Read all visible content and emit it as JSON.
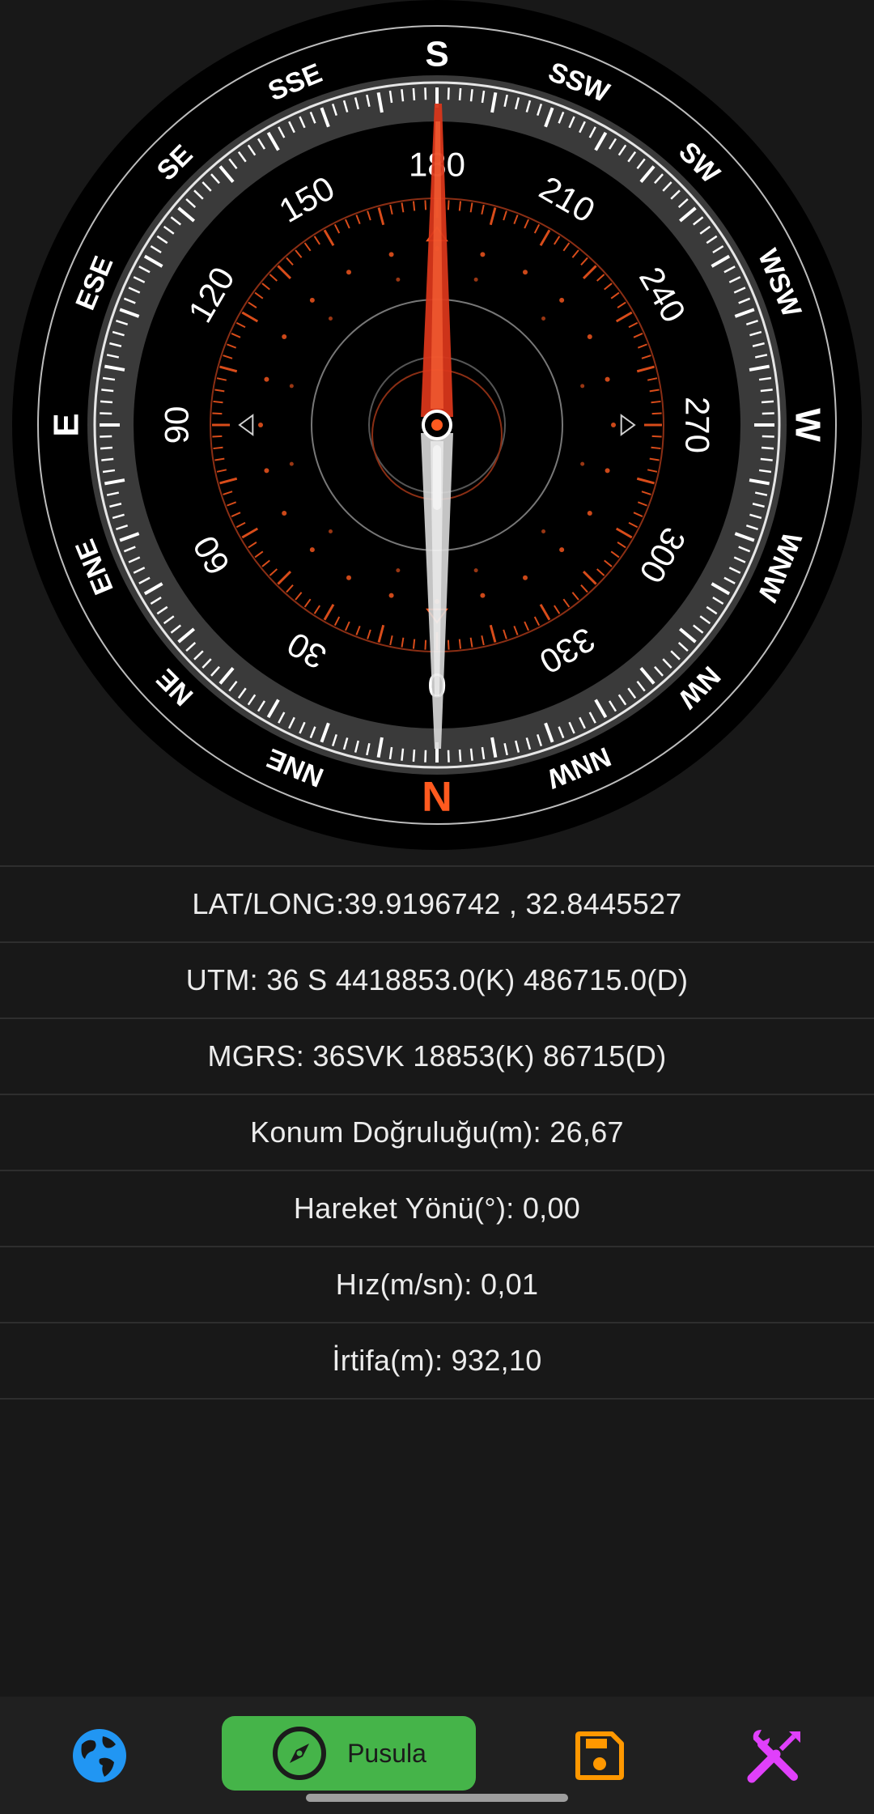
{
  "compass": {
    "cardinals": {
      "north": "N",
      "south": "S",
      "east": "E",
      "west": "W"
    },
    "intercardinals": [
      "NNE",
      "NE",
      "ENE",
      "ESE",
      "SE",
      "SSE",
      "SSW",
      "SW",
      "WSW",
      "WNW",
      "NW",
      "NNW"
    ],
    "degree_labels": [
      "0",
      "30",
      "60",
      "90",
      "120",
      "150",
      "180",
      "210",
      "240",
      "270",
      "300",
      "330"
    ],
    "colors": {
      "accent": "#ff5a1f",
      "needle_red": "#d8361a",
      "needle_white": "#d9d9d9"
    }
  },
  "info": {
    "latlong": "LAT/LONG:39.9196742 , 32.8445527",
    "utm": "UTM: 36 S 4418853.0(K) 486715.0(D)",
    "mgrs": "MGRS: 36SVK 18853(K) 86715(D)",
    "accuracy": "Konum Doğruluğu(m): 26,67",
    "heading": "Hareket Yönü(°): 0,00",
    "speed": "Hız(m/sn): 0,01",
    "altitude": "İrtifa(m): 932,10"
  },
  "nav": {
    "active_label": "Pusula",
    "colors": {
      "globe": "#2196f3",
      "active_bg": "#45b449",
      "save": "#ff9800",
      "tools": "#e040fb"
    }
  }
}
